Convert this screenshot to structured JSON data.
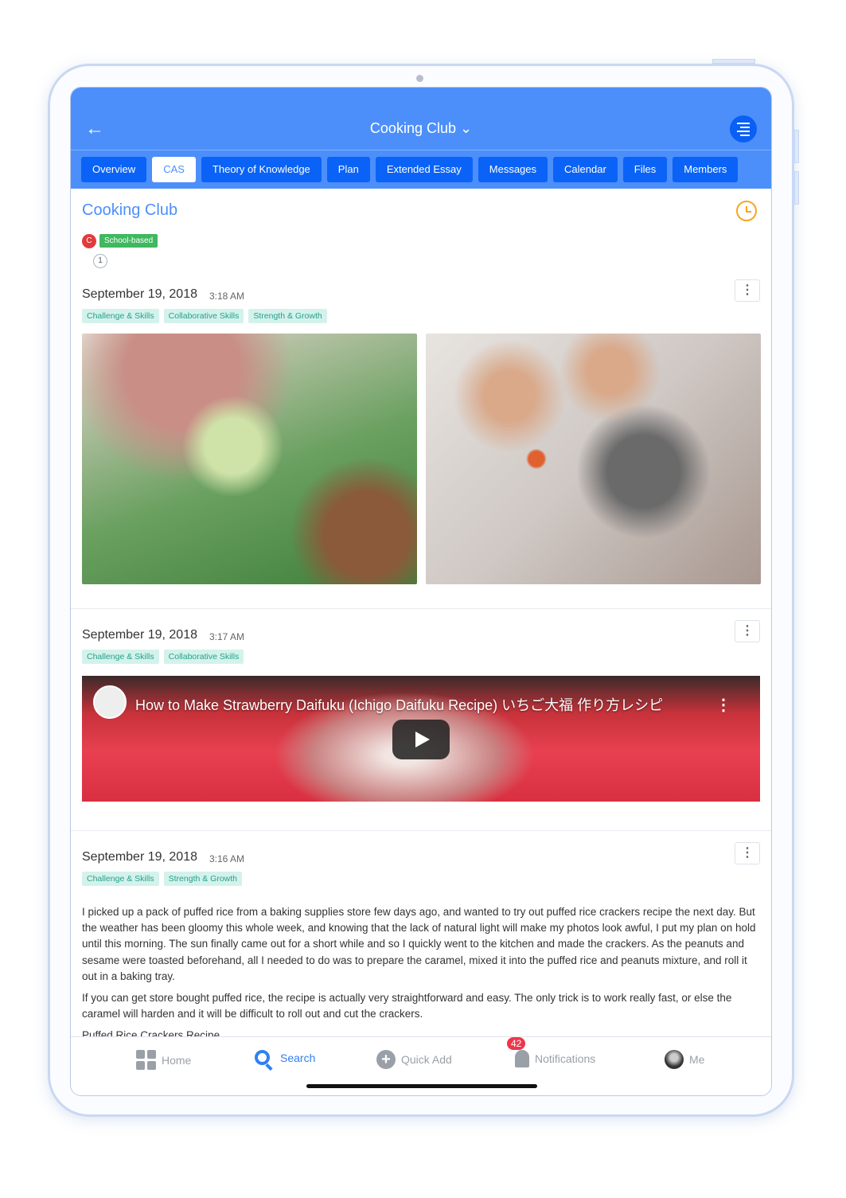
{
  "header": {
    "title": "Cooking Club",
    "tabs": [
      "Overview",
      "CAS",
      "Theory of Knowledge",
      "Plan",
      "Extended Essay",
      "Messages",
      "Calendar",
      "Files",
      "Members"
    ],
    "active_tab": "CAS"
  },
  "club": {
    "name": "Cooking Club",
    "initial": "C",
    "type": "School-based",
    "comments": "1"
  },
  "posts": [
    {
      "date": "September 19, 2018",
      "time": "3:18 AM",
      "tags": [
        "Challenge & Skills",
        "Collaborative Skills",
        "Strength & Growth"
      ]
    },
    {
      "date": "September 19, 2018",
      "time": "3:17 AM",
      "tags": [
        "Challenge & Skills",
        "Collaborative Skills"
      ],
      "video_title": "How to Make Strawberry Daifuku (Ichigo Daifuku Recipe) いちご大福 作り方レシピ"
    },
    {
      "date": "September 19, 2018",
      "time": "3:16 AM",
      "tags": [
        "Challenge & Skills",
        "Strength & Growth"
      ],
      "paragraphs": [
        "I picked up a pack of puffed rice from a baking supplies store few days ago, and wanted to try out puffed rice crackers recipe the next day. But the weather has been gloomy this whole week, and knowing that the lack of natural light will make my photos look awful, I put my plan on hold until this morning. The sun finally came out for a short while and so I quickly went to the kitchen and made the crackers. As the peanuts and sesame were toasted beforehand, all I needed to do was to prepare the caramel, mixed it into the puffed rice and peanuts mixture, and roll it out in a baking tray.",
        "If you can get store bought puffed rice, the recipe is actually very straightforward and easy. The only trick is to work really fast, or else the caramel will harden and it will be difficult to roll out and cut the crackers.",
        "Puffed Rice Crackers Recipe"
      ]
    }
  ],
  "tabbar": {
    "home": "Home",
    "search": "Search",
    "quick_add": "Quick Add",
    "notifications": "Notifications",
    "notification_count": "42",
    "me": "Me",
    "active": "Search"
  },
  "colors": {
    "brand": "#4c8ffb",
    "tab": "#0a63f6",
    "tag_bg": "#d4f2ec",
    "tag_text": "#27a08a",
    "school": "#3fb85f",
    "badge": "#f0354a"
  }
}
